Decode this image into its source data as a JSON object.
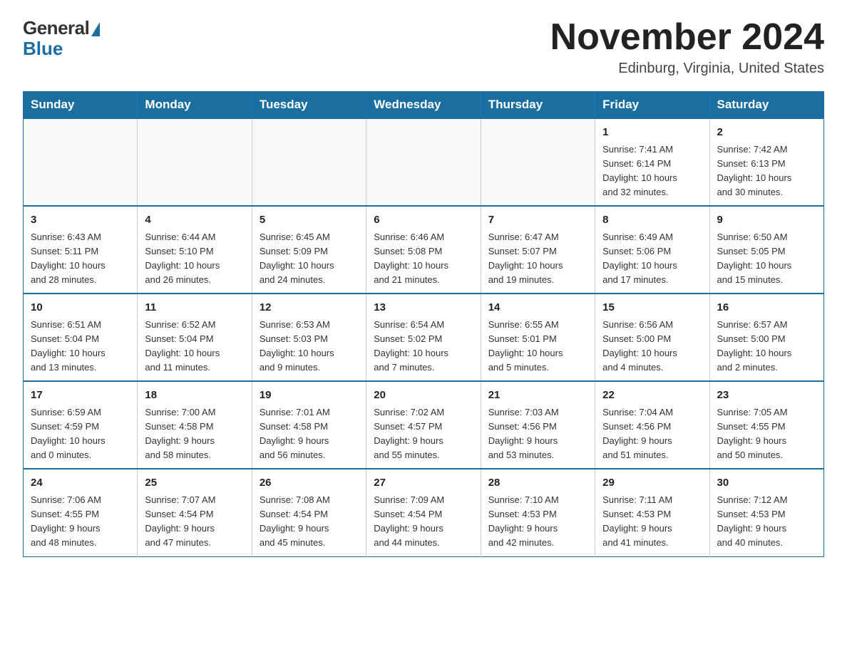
{
  "logo": {
    "general": "General",
    "blue": "Blue"
  },
  "title": "November 2024",
  "location": "Edinburg, Virginia, United States",
  "days_of_week": [
    "Sunday",
    "Monday",
    "Tuesday",
    "Wednesday",
    "Thursday",
    "Friday",
    "Saturday"
  ],
  "weeks": [
    [
      {
        "day": "",
        "info": ""
      },
      {
        "day": "",
        "info": ""
      },
      {
        "day": "",
        "info": ""
      },
      {
        "day": "",
        "info": ""
      },
      {
        "day": "",
        "info": ""
      },
      {
        "day": "1",
        "info": "Sunrise: 7:41 AM\nSunset: 6:14 PM\nDaylight: 10 hours\nand 32 minutes."
      },
      {
        "day": "2",
        "info": "Sunrise: 7:42 AM\nSunset: 6:13 PM\nDaylight: 10 hours\nand 30 minutes."
      }
    ],
    [
      {
        "day": "3",
        "info": "Sunrise: 6:43 AM\nSunset: 5:11 PM\nDaylight: 10 hours\nand 28 minutes."
      },
      {
        "day": "4",
        "info": "Sunrise: 6:44 AM\nSunset: 5:10 PM\nDaylight: 10 hours\nand 26 minutes."
      },
      {
        "day": "5",
        "info": "Sunrise: 6:45 AM\nSunset: 5:09 PM\nDaylight: 10 hours\nand 24 minutes."
      },
      {
        "day": "6",
        "info": "Sunrise: 6:46 AM\nSunset: 5:08 PM\nDaylight: 10 hours\nand 21 minutes."
      },
      {
        "day": "7",
        "info": "Sunrise: 6:47 AM\nSunset: 5:07 PM\nDaylight: 10 hours\nand 19 minutes."
      },
      {
        "day": "8",
        "info": "Sunrise: 6:49 AM\nSunset: 5:06 PM\nDaylight: 10 hours\nand 17 minutes."
      },
      {
        "day": "9",
        "info": "Sunrise: 6:50 AM\nSunset: 5:05 PM\nDaylight: 10 hours\nand 15 minutes."
      }
    ],
    [
      {
        "day": "10",
        "info": "Sunrise: 6:51 AM\nSunset: 5:04 PM\nDaylight: 10 hours\nand 13 minutes."
      },
      {
        "day": "11",
        "info": "Sunrise: 6:52 AM\nSunset: 5:04 PM\nDaylight: 10 hours\nand 11 minutes."
      },
      {
        "day": "12",
        "info": "Sunrise: 6:53 AM\nSunset: 5:03 PM\nDaylight: 10 hours\nand 9 minutes."
      },
      {
        "day": "13",
        "info": "Sunrise: 6:54 AM\nSunset: 5:02 PM\nDaylight: 10 hours\nand 7 minutes."
      },
      {
        "day": "14",
        "info": "Sunrise: 6:55 AM\nSunset: 5:01 PM\nDaylight: 10 hours\nand 5 minutes."
      },
      {
        "day": "15",
        "info": "Sunrise: 6:56 AM\nSunset: 5:00 PM\nDaylight: 10 hours\nand 4 minutes."
      },
      {
        "day": "16",
        "info": "Sunrise: 6:57 AM\nSunset: 5:00 PM\nDaylight: 10 hours\nand 2 minutes."
      }
    ],
    [
      {
        "day": "17",
        "info": "Sunrise: 6:59 AM\nSunset: 4:59 PM\nDaylight: 10 hours\nand 0 minutes."
      },
      {
        "day": "18",
        "info": "Sunrise: 7:00 AM\nSunset: 4:58 PM\nDaylight: 9 hours\nand 58 minutes."
      },
      {
        "day": "19",
        "info": "Sunrise: 7:01 AM\nSunset: 4:58 PM\nDaylight: 9 hours\nand 56 minutes."
      },
      {
        "day": "20",
        "info": "Sunrise: 7:02 AM\nSunset: 4:57 PM\nDaylight: 9 hours\nand 55 minutes."
      },
      {
        "day": "21",
        "info": "Sunrise: 7:03 AM\nSunset: 4:56 PM\nDaylight: 9 hours\nand 53 minutes."
      },
      {
        "day": "22",
        "info": "Sunrise: 7:04 AM\nSunset: 4:56 PM\nDaylight: 9 hours\nand 51 minutes."
      },
      {
        "day": "23",
        "info": "Sunrise: 7:05 AM\nSunset: 4:55 PM\nDaylight: 9 hours\nand 50 minutes."
      }
    ],
    [
      {
        "day": "24",
        "info": "Sunrise: 7:06 AM\nSunset: 4:55 PM\nDaylight: 9 hours\nand 48 minutes."
      },
      {
        "day": "25",
        "info": "Sunrise: 7:07 AM\nSunset: 4:54 PM\nDaylight: 9 hours\nand 47 minutes."
      },
      {
        "day": "26",
        "info": "Sunrise: 7:08 AM\nSunset: 4:54 PM\nDaylight: 9 hours\nand 45 minutes."
      },
      {
        "day": "27",
        "info": "Sunrise: 7:09 AM\nSunset: 4:54 PM\nDaylight: 9 hours\nand 44 minutes."
      },
      {
        "day": "28",
        "info": "Sunrise: 7:10 AM\nSunset: 4:53 PM\nDaylight: 9 hours\nand 42 minutes."
      },
      {
        "day": "29",
        "info": "Sunrise: 7:11 AM\nSunset: 4:53 PM\nDaylight: 9 hours\nand 41 minutes."
      },
      {
        "day": "30",
        "info": "Sunrise: 7:12 AM\nSunset: 4:53 PM\nDaylight: 9 hours\nand 40 minutes."
      }
    ]
  ]
}
